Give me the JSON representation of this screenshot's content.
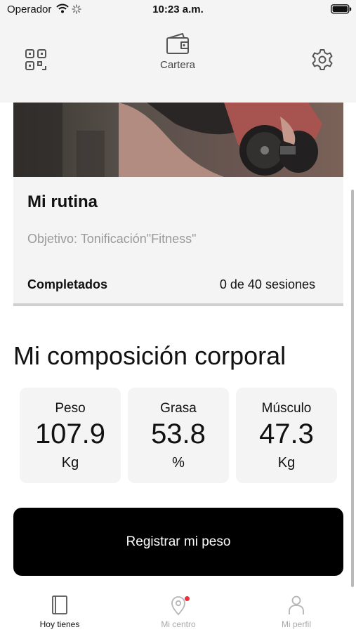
{
  "status_bar": {
    "carrier": "Operador",
    "time": "10:23 a.m.",
    "icons": [
      "wifi-icon",
      "activity-icon",
      "battery-icon"
    ]
  },
  "top_bar": {
    "qr_icon": "qr-code-icon",
    "wallet_icon": "wallet-icon",
    "wallet_label": "Cartera",
    "settings_icon": "gear-icon"
  },
  "routine": {
    "title": "Mi rutina",
    "goal": "Objetivo: Tonificación\"Fitness\"",
    "completed_label": "Completados",
    "completed_value": "0 de 40 sesiones"
  },
  "composition": {
    "title": "Mi composición corporal",
    "metrics": [
      {
        "label": "Peso",
        "value": "107.9",
        "unit": "Kg"
      },
      {
        "label": "Grasa",
        "value": "53.8",
        "unit": "%"
      },
      {
        "label": "Músculo",
        "value": "47.3",
        "unit": "Kg"
      }
    ]
  },
  "actions": {
    "register_label": "Registrar mi peso"
  },
  "tabs": [
    {
      "label": "Hoy tienes",
      "icon": "book-icon",
      "active": true
    },
    {
      "label": "Mi centro",
      "icon": "location-pin-icon",
      "active": false,
      "badge": true
    },
    {
      "label": "Mi perfil",
      "icon": "person-icon",
      "active": false
    }
  ],
  "colors": {
    "header_background": "#f4f4f4",
    "primary_button": "#000000",
    "notification_dot": "#e8323c",
    "inactive_tab": "#a8a8a8"
  }
}
